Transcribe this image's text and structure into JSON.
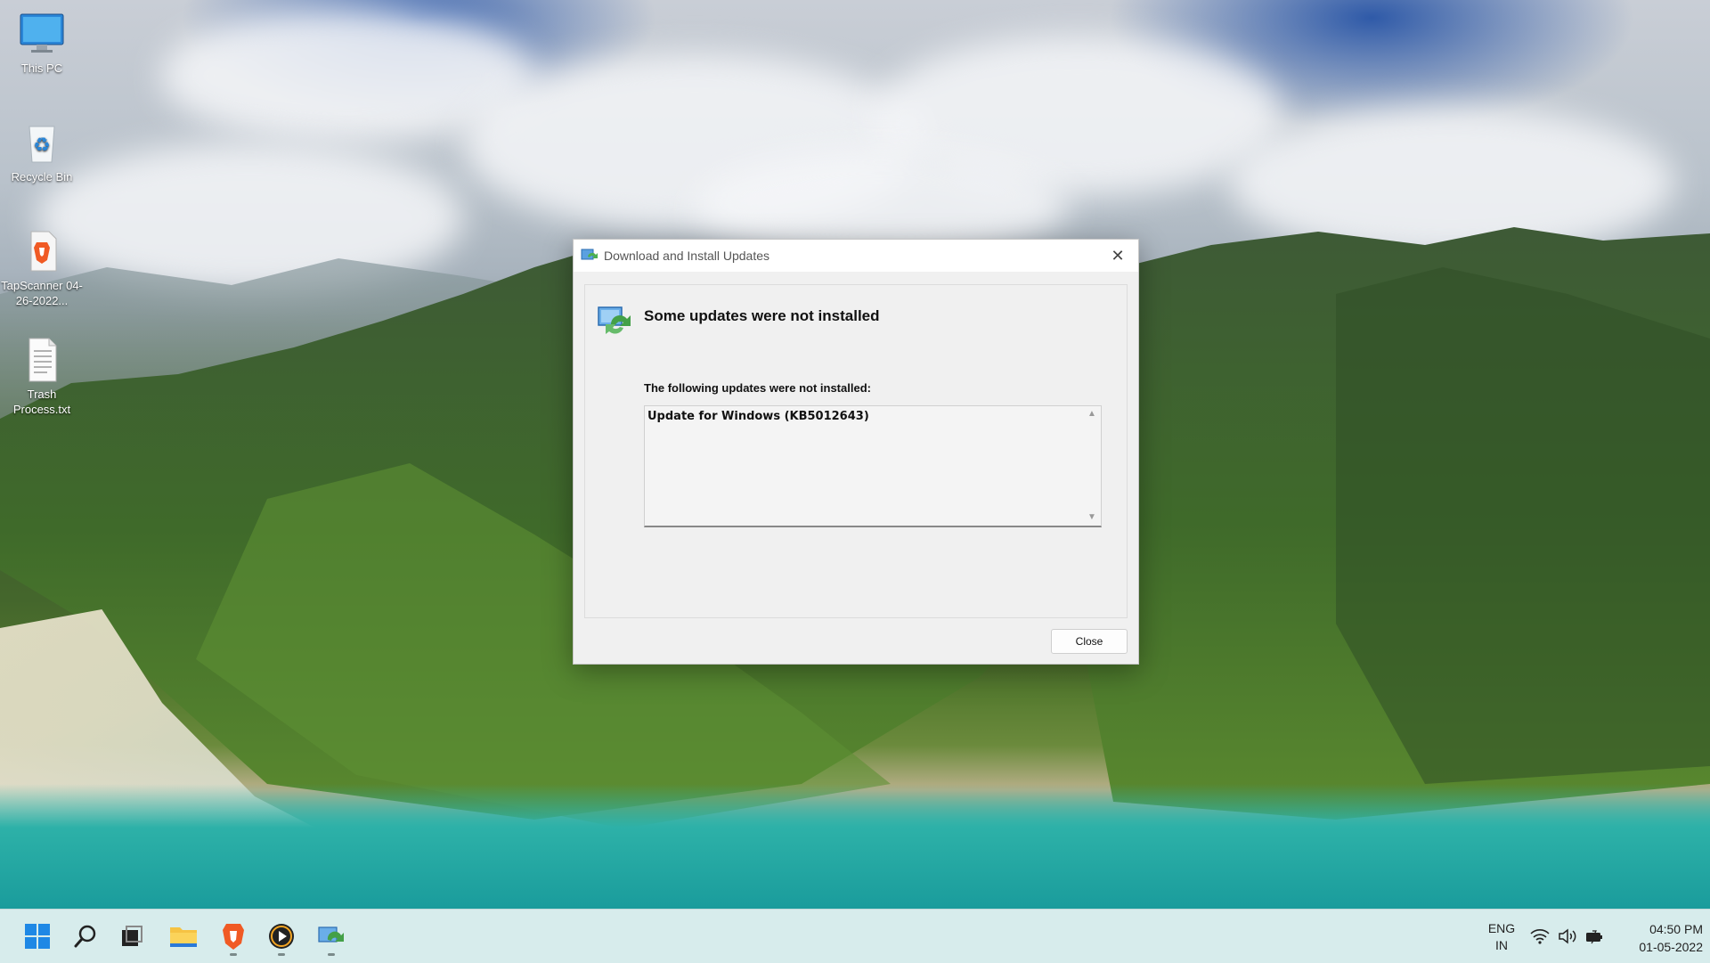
{
  "desktop": {
    "icons": [
      {
        "label": "This PC",
        "icon": "computer-monitor-icon"
      },
      {
        "label": "Recycle Bin",
        "icon": "recycle-bin-icon"
      },
      {
        "label": "TapScanner 04-26-2022...",
        "icon": "brave-browser-icon"
      },
      {
        "label": "Trash Process.txt",
        "icon": "text-file-icon"
      }
    ]
  },
  "dialog": {
    "title": "Download and Install Updates",
    "close_glyph": "✕",
    "heading": "Some updates were not installed",
    "subheading": "The following updates were not installed:",
    "list_items": [
      "Update for Windows (KB5012643)"
    ],
    "scroll_up_glyph": "▲",
    "scroll_down_glyph": "▼",
    "close_button_label": "Close"
  },
  "taskbar": {
    "apps": [
      {
        "name": "start",
        "icon": "windows-start-icon"
      },
      {
        "name": "search",
        "icon": "search-icon"
      },
      {
        "name": "task-view",
        "icon": "task-view-icon"
      },
      {
        "name": "file-explorer",
        "icon": "folder-icon"
      },
      {
        "name": "brave",
        "icon": "brave-browser-icon"
      },
      {
        "name": "media-player",
        "icon": "media-player-icon"
      },
      {
        "name": "windows-update",
        "icon": "windows-update-icon"
      }
    ],
    "tray": {
      "language_line1": "ENG",
      "language_line2": "IN",
      "wifi_icon": "wifi-icon",
      "volume_icon": "volume-icon",
      "battery_icon": "battery-icon",
      "time": "04:50 PM",
      "date": "01-05-2022"
    }
  },
  "colors": {
    "taskbar_bg": "#d7ecec",
    "dialog_bg": "#f0f0f0",
    "accent_green": "#4caf50",
    "accent_blue": "#2b79d8"
  }
}
